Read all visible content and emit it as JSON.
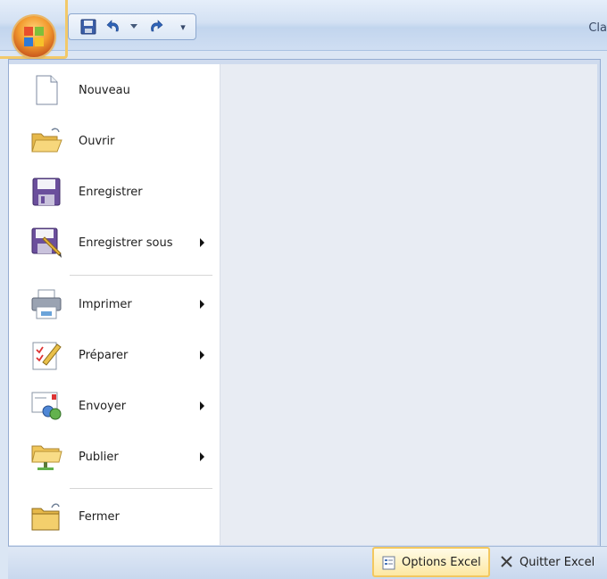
{
  "window": {
    "title_partial": "Cla"
  },
  "quick_access": {
    "save_icon": "save-icon",
    "undo_icon": "undo-icon",
    "redo_icon": "redo-icon",
    "customize_symbol": "▾"
  },
  "office_menu": {
    "items": [
      {
        "label": "Nouveau",
        "icon": "new-document-icon",
        "submenu": false
      },
      {
        "label": "Ouvrir",
        "icon": "open-folder-icon",
        "submenu": false
      },
      {
        "label": "Enregistrer",
        "icon": "save-icon",
        "submenu": false
      },
      {
        "label": "Enregistrer sous",
        "icon": "save-as-icon",
        "submenu": true
      },
      {
        "label": "Imprimer",
        "icon": "printer-icon",
        "submenu": true
      },
      {
        "label": "Préparer",
        "icon": "prepare-icon",
        "submenu": true
      },
      {
        "label": "Envoyer",
        "icon": "send-icon",
        "submenu": true
      },
      {
        "label": "Publier",
        "icon": "publish-icon",
        "submenu": true
      },
      {
        "label": "Fermer",
        "icon": "close-folder-icon",
        "submenu": false
      }
    ]
  },
  "footer": {
    "options_label": "Options Excel",
    "quit_label": "Quitter Excel"
  },
  "colors": {
    "highlight_border": "#f3c85f",
    "menu_background": "#ffffff",
    "right_pane": "#e8ecf3"
  }
}
